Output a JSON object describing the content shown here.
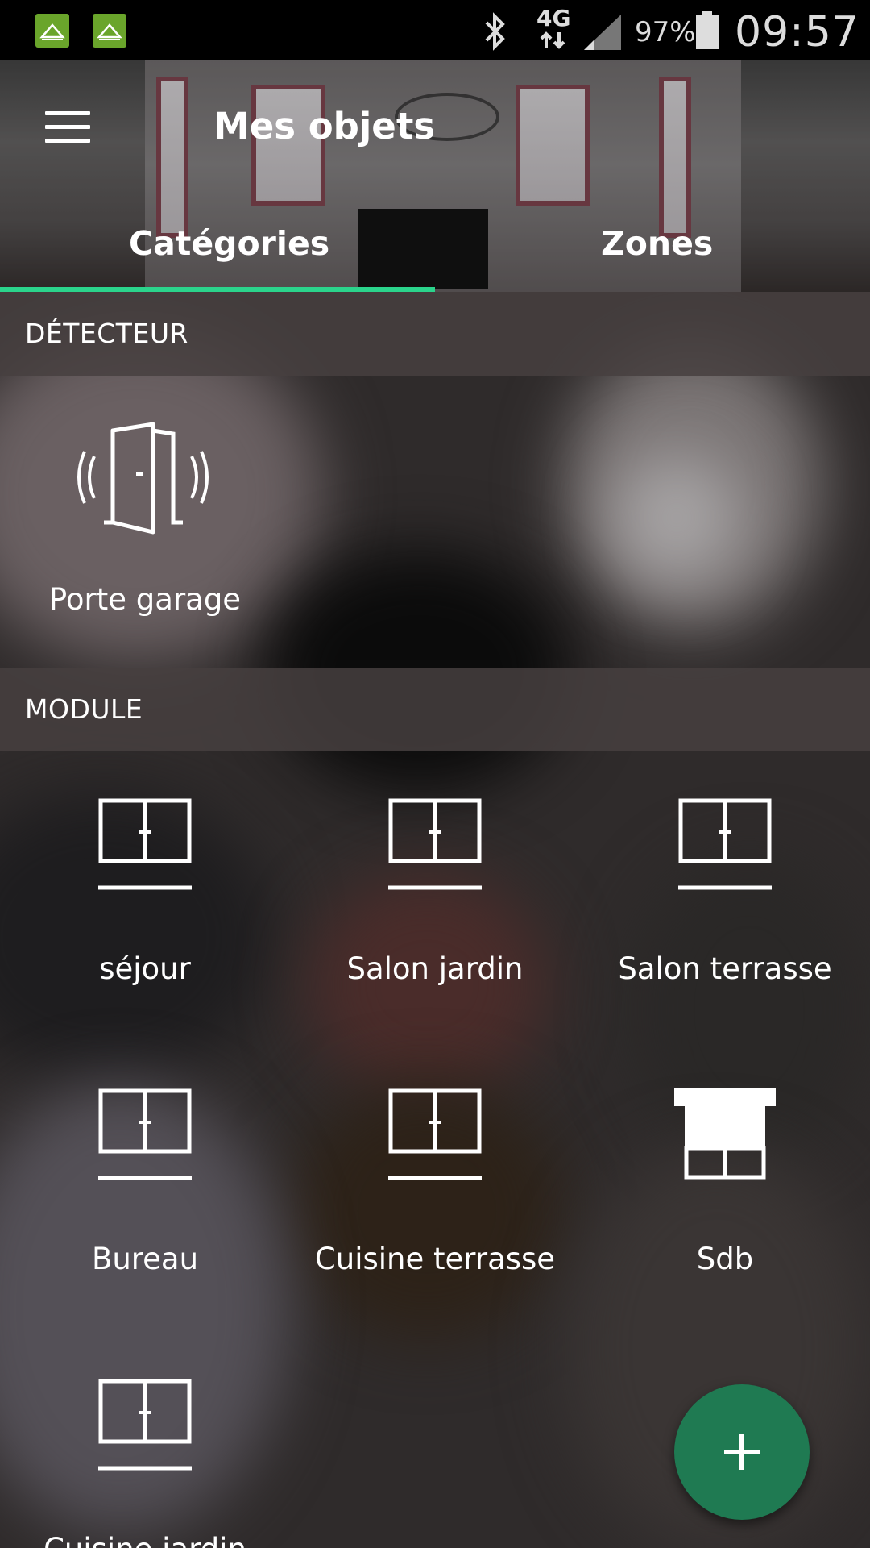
{
  "status_bar": {
    "notification_icons": [
      "app-notification-icon",
      "app-notification-icon"
    ],
    "network": "4G",
    "battery": "97%",
    "time": "09:57"
  },
  "header": {
    "title": "Mes objets",
    "tabs": [
      {
        "label": "Catégories",
        "active": true
      },
      {
        "label": "Zones",
        "active": false
      }
    ],
    "accent_color": "#2bd48c"
  },
  "sections": [
    {
      "title": "DÉTECTEUR",
      "items": [
        {
          "label": "Porte garage",
          "icon": "door-sensor-icon"
        }
      ]
    },
    {
      "title": "MODULE",
      "items": [
        {
          "label": "séjour",
          "icon": "window-icon"
        },
        {
          "label": "Salon jardin",
          "icon": "window-icon"
        },
        {
          "label": "Salon terrasse",
          "icon": "window-icon"
        },
        {
          "label": "Bureau",
          "icon": "window-icon"
        },
        {
          "label": "Cuisine terrasse",
          "icon": "window-icon"
        },
        {
          "label": "Sdb",
          "icon": "roller-shutter-icon"
        },
        {
          "label": "Cuisine jardin",
          "icon": "window-icon"
        }
      ]
    }
  ],
  "fab": {
    "icon": "plus-icon",
    "color": "#1f7a52"
  }
}
